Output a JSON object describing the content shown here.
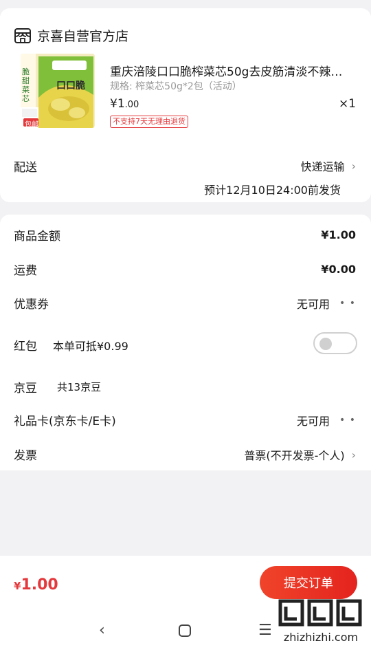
{
  "store": {
    "name": "京喜自营官方店"
  },
  "product": {
    "title": "重庆涪陵口口脆榨菜芯50g去皮筋清淡不辣…",
    "spec": "规格: 榨菜芯50g*2包（活动）",
    "price_yen": "¥1",
    "price_cents": ".00",
    "quantity": "×1",
    "no_return_badge": "不支持7天无理由退货",
    "image_text": {
      "side": "脆甜菜芯",
      "brand": "口口脆",
      "tag": "包邮"
    }
  },
  "delivery": {
    "label": "配送",
    "method": "快递运输",
    "estimate": "预计12月10日24:00前发货"
  },
  "fees": {
    "goods_label": "商品金额",
    "goods_value": "¥1.00",
    "shipping_label": "运费",
    "shipping_value": "¥0.00",
    "coupon_label": "优惠券",
    "coupon_value": "无可用",
    "redpacket_label": "红包",
    "redpacket_desc": "本单可抵¥0.99",
    "jingdou_label": "京豆",
    "jingdou_desc": "共13京豆",
    "giftcard_label": "礼品卡(京东卡/E卡)",
    "giftcard_value": "无可用",
    "invoice_label": "发票",
    "invoice_value": "普票(不开发票-个人)"
  },
  "footer": {
    "total_yen": "¥",
    "total_value": "1.00",
    "submit_label": "提交订单"
  },
  "watermark": {
    "url": "zhizhizhi.com"
  },
  "colors": {
    "accent": "#e4393c"
  }
}
